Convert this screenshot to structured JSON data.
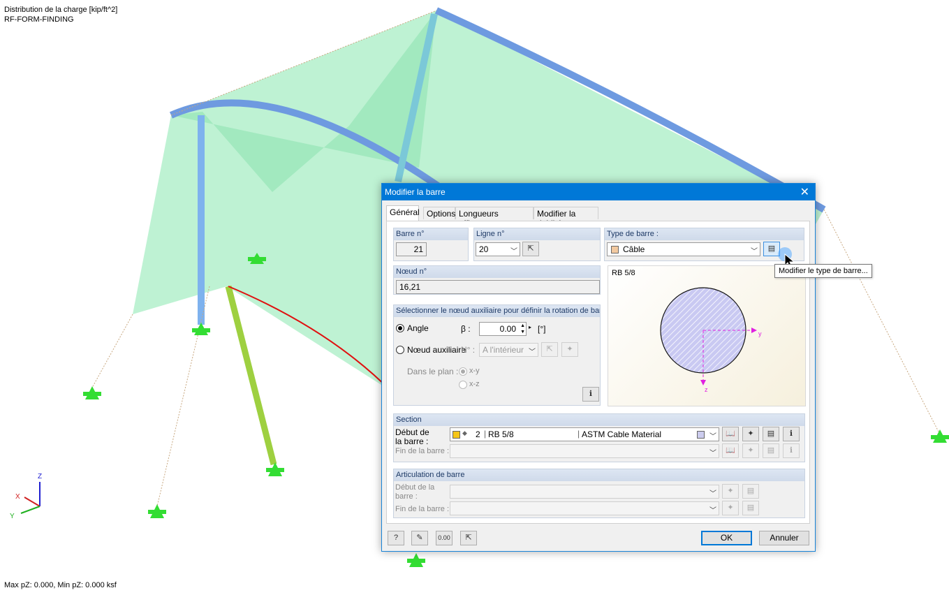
{
  "viewport": {
    "title_line1": "Distribution de la charge [kip/ft^2]",
    "title_line2": "RF-FORM-FINDING",
    "status": "Max pZ: 0.000, Min pZ: 0.000 ksf",
    "axes": {
      "x": "X",
      "y": "Y",
      "z": "Z"
    }
  },
  "dialog": {
    "title": "Modifier la barre",
    "close": "✕",
    "tabs": [
      "Général",
      "Options",
      "Longueurs efficaces",
      "Modifier la rigidité"
    ],
    "barre_no": {
      "label": "Barre n°",
      "value": "21"
    },
    "ligne_no": {
      "label": "Ligne n°",
      "value": "20"
    },
    "type_barre": {
      "label": "Type de barre :",
      "value": "Câble",
      "color": "#f2c9a0"
    },
    "noeud_no": {
      "label": "Nœud n°",
      "value": "16,21"
    },
    "rotation": {
      "header": "Sélectionner le nœud auxiliaire pour définir la rotation de barr",
      "angle_label": "Angle",
      "beta_label": "β :",
      "beta_value": "0.00",
      "beta_unit": "[°]",
      "aux_label": "Nœud auxiliaire",
      "no_label": "N° :",
      "aux_value": "A l'intérieur",
      "plane_label": "Dans le plan :",
      "plane_xy": "x-y",
      "plane_xz": "x-z"
    },
    "preview": {
      "section_name": "RB 5/8",
      "axis_y": "y",
      "axis_z": "z"
    },
    "section": {
      "header": "Section",
      "start_label": "Début de la barre :",
      "start_no": "2",
      "start_name": "RB 5/8",
      "start_material": "ASTM Cable Material",
      "start_color": "#f5c518",
      "end_label": "Fin de la barre :"
    },
    "articulation": {
      "header": "Articulation de barre",
      "start_label": "Début de la barre :",
      "end_label": "Fin de la barre :"
    },
    "buttons": {
      "ok": "OK",
      "cancel": "Annuler"
    }
  },
  "tooltip": "Modifier le type de barre..."
}
